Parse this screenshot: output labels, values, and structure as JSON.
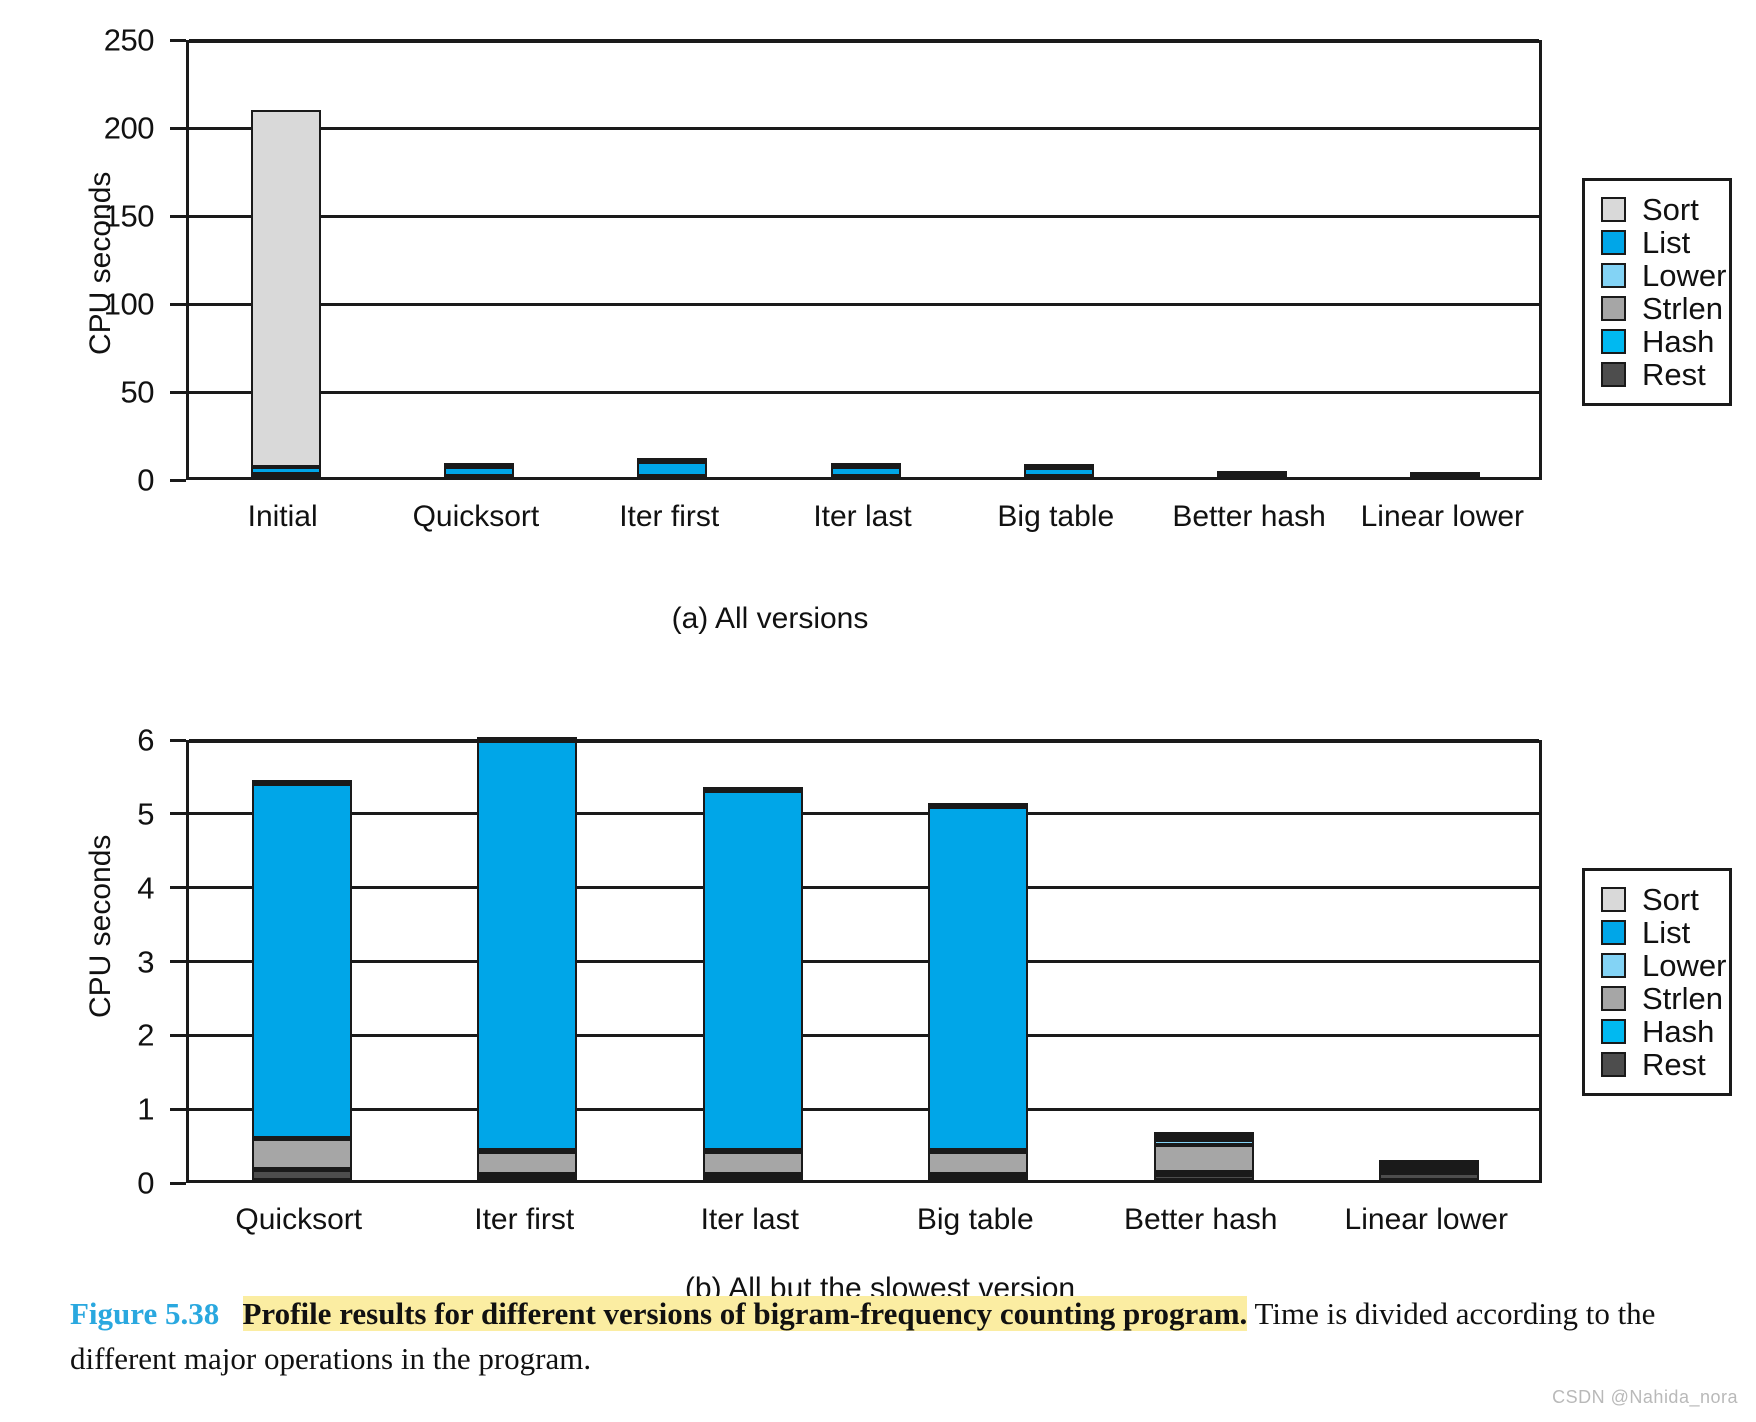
{
  "caption": {
    "figure_number": "Figure 5.38",
    "highlight": "Profile results for different versions of bigram-frequency counting program.",
    "rest": " Time is divided according to the different major operations in the program."
  },
  "watermark": "CSDN @Nahida_nora",
  "legend": {
    "items": [
      {
        "label": "Sort",
        "color": "#d9d9d9"
      },
      {
        "label": "List",
        "color": "#00a6e8"
      },
      {
        "label": "Lower",
        "color": "#83d3f5"
      },
      {
        "label": "Strlen",
        "color": "#a6a6a6"
      },
      {
        "label": "Hash",
        "color": "#00b9f1"
      },
      {
        "label": "Rest",
        "color": "#4d4d4d"
      }
    ]
  },
  "chart_data": [
    {
      "id": "panel-a",
      "type": "bar",
      "stacked": true,
      "title": "(a) All versions",
      "xlabel": "",
      "ylabel": "CPU seconds",
      "ylim": [
        0,
        250
      ],
      "yticks": [
        0,
        50,
        100,
        150,
        200,
        250
      ],
      "grid": true,
      "legend_position": "right",
      "categories": [
        "Initial",
        "Quicksort",
        "Iter first",
        "Iter last",
        "Big table",
        "Better hash",
        "Linear lower"
      ],
      "series": [
        {
          "name": "Rest",
          "color": "#4d4d4d",
          "values": [
            0.2,
            0.15,
            0.1,
            0.1,
            0.1,
            0.1,
            0.15
          ]
        },
        {
          "name": "Hash",
          "color": "#00b9f1",
          "values": [
            0.3,
            0.1,
            0.1,
            0.1,
            0.1,
            0.1,
            0.1
          ]
        },
        {
          "name": "Strlen",
          "color": "#a6a6a6",
          "values": [
            0.5,
            0.4,
            0.4,
            0.4,
            0.4,
            0.45,
            0.1
          ]
        },
        {
          "name": "Lower",
          "color": "#83d3f5",
          "values": [
            0.5,
            0.1,
            0.1,
            0.1,
            0.1,
            0.15,
            0.1
          ]
        },
        {
          "name": "List",
          "color": "#00a6e8",
          "values": [
            4.3,
            4.8,
            7.6,
            4.8,
            4.6,
            0.1,
            0.1
          ]
        },
        {
          "name": "Sort",
          "color": "#d9d9d9",
          "values": [
            203.0,
            0.3,
            0.4,
            0.3,
            0.3,
            0.3,
            1.2
          ]
        }
      ],
      "totals": [
        208.8,
        5.85,
        8.7,
        5.8,
        5.6,
        1.2,
        1.75
      ]
    },
    {
      "id": "panel-b",
      "type": "bar",
      "stacked": true,
      "title": "(b) All but the slowest version",
      "xlabel": "",
      "ylabel": "CPU seconds",
      "ylim": [
        0,
        6
      ],
      "yticks": [
        0,
        1,
        2,
        3,
        4,
        5,
        6
      ],
      "grid": true,
      "legend_position": "right",
      "categories": [
        "Quicksort",
        "Iter first",
        "Iter last",
        "Big table",
        "Better hash",
        "Linear lower"
      ],
      "series": [
        {
          "name": "Rest",
          "color": "#4d4d4d",
          "values": [
            0.13,
            0.04,
            0.04,
            0.04,
            0.07,
            0.1
          ]
        },
        {
          "name": "Hash",
          "color": "#00b9f1",
          "values": [
            0.02,
            0.04,
            0.04,
            0.04,
            0.04,
            0.02
          ]
        },
        {
          "name": "Strlen",
          "color": "#a6a6a6",
          "values": [
            0.4,
            0.3,
            0.3,
            0.3,
            0.36,
            0.04
          ]
        },
        {
          "name": "Lower",
          "color": "#83d3f5",
          "values": [
            0.02,
            0.02,
            0.02,
            0.02,
            0.07,
            0.03
          ]
        },
        {
          "name": "List",
          "color": "#00a6e8",
          "values": [
            4.8,
            5.55,
            4.87,
            4.65,
            0.06,
            0.03
          ]
        },
        {
          "name": "Sort",
          "color": "#d9d9d9",
          "values": [
            0.05,
            0.05,
            0.05,
            0.05,
            0.05,
            0.05
          ]
        }
      ],
      "totals": [
        5.42,
        6.0,
        5.32,
        5.1,
        0.65,
        0.27
      ]
    }
  ]
}
